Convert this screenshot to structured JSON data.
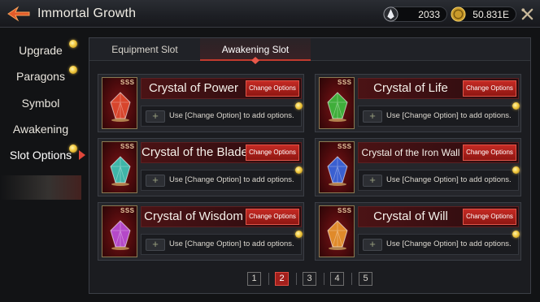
{
  "header": {
    "title": "Immortal Growth",
    "currency_1": {
      "value": "2033",
      "icon": "crystal-shard-icon"
    },
    "currency_2": {
      "value": "50.831E",
      "icon": "gold-coin-icon"
    },
    "tools_icon": "crossed-tools-icon"
  },
  "nav": {
    "items": [
      {
        "label": "Upgrade"
      },
      {
        "label": "Paragons"
      },
      {
        "label": "Symbol"
      },
      {
        "label": "Awakening"
      },
      {
        "label": "Slot Options"
      }
    ],
    "active": "Slot Options"
  },
  "tabs": [
    {
      "label": "Equipment Slot"
    },
    {
      "label": "Awakening Slot"
    }
  ],
  "active_tab": "Awakening Slot",
  "slots": [
    {
      "name": "Crystal of Power",
      "rank": "SSS",
      "button": "Change Options",
      "option_text": "Use [Change Option] to add options.",
      "color": "#d8452c"
    },
    {
      "name": "Crystal of Life",
      "rank": "SSS",
      "button": "Change Options",
      "option_text": "Use [Change Option] to add options.",
      "color": "#3fae3a"
    },
    {
      "name": "Crystal of the Blade",
      "rank": "SSS",
      "button": "Change Options",
      "option_text": "Use [Change Option] to add options.",
      "color": "#3fb5a8"
    },
    {
      "name": "Crystal of the Iron Wall",
      "rank": "SSS",
      "button": "Change Options",
      "option_text": "Use [Change Option] to add options.",
      "color": "#3a5fd0"
    },
    {
      "name": "Crystal of Wisdom",
      "rank": "SSS",
      "button": "Change Options",
      "option_text": "Use [Change Option] to add options.",
      "color": "#b548c8"
    },
    {
      "name": "Crystal of Will",
      "rank": "SSS",
      "button": "Change Options",
      "option_text": "Use [Change Option] to add options.",
      "color": "#e08a2a"
    }
  ],
  "pagination": {
    "pages": [
      "1",
      "2",
      "3",
      "4",
      "5"
    ],
    "current": "2"
  }
}
